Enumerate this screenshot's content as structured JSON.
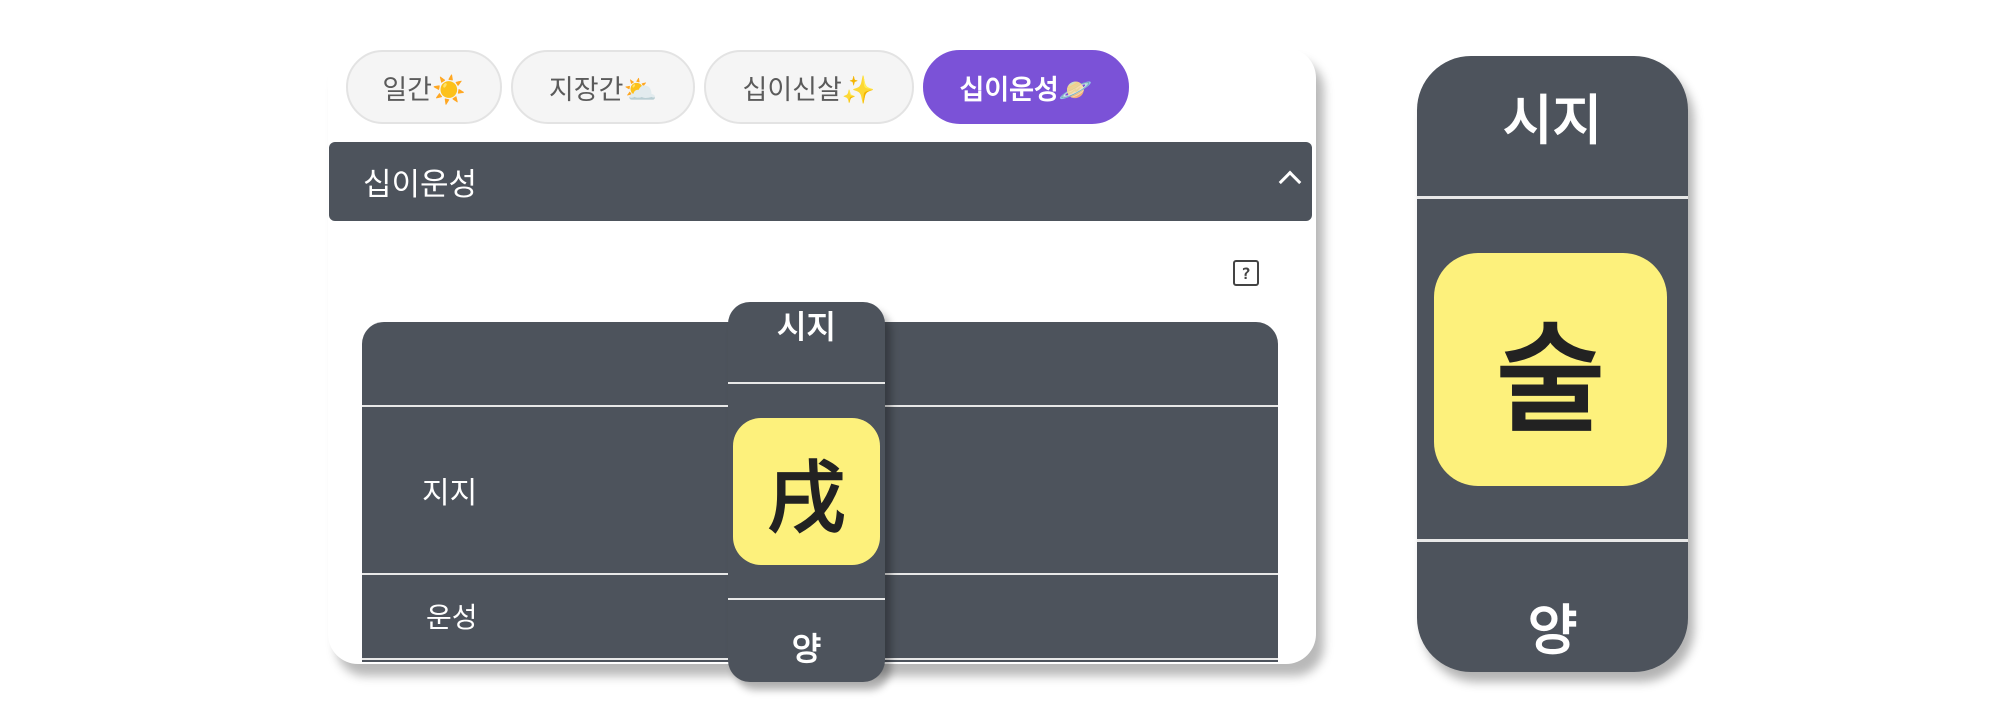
{
  "tabs": [
    {
      "label": "일간☀️"
    },
    {
      "label": "지장간⛅"
    },
    {
      "label": "십이신살✨"
    },
    {
      "label": "십이운성🪐"
    }
  ],
  "active_tab": 3,
  "accordion": {
    "title": "십이운성",
    "state": "expanded"
  },
  "help_icon": {
    "glyph": "?"
  },
  "table": {
    "rows": [
      "",
      "지지",
      "운성"
    ]
  },
  "highlight_column": {
    "header": "시지",
    "value_hanja": "戌",
    "value_hangul": "술",
    "fortune": "양"
  },
  "colors": {
    "accent": "#7b52d7",
    "panel": "#4d535c",
    "highlight": "#fdf17c"
  }
}
